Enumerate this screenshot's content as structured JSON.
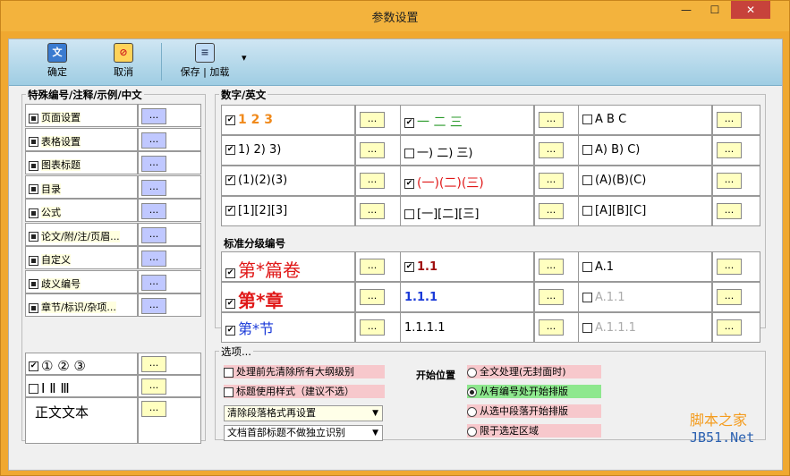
{
  "window": {
    "title": "参数设置",
    "minimize": "—",
    "maximize": "☐",
    "close": "✕"
  },
  "toolbar": {
    "confirm": "确定",
    "cancel": "取消",
    "saveload": "保存 | 加载",
    "confirm_icon": "文",
    "cancel_icon": "⊘",
    "save_icon": "≡",
    "drop": "▾"
  },
  "left": {
    "title": "特殊编号/注释/示例/中文",
    "items": [
      "页面设置",
      "表格设置",
      "图表标题",
      "目录",
      "公式",
      "论文/附/注/页眉...",
      "自定义",
      "歧义编号",
      "章节/标识/杂项..."
    ],
    "circ": "① ② ③",
    "roman": "Ⅰ Ⅱ Ⅲ",
    "body": "正文文本"
  },
  "dots": "...",
  "num": {
    "title": "数字/英文",
    "rows": [
      [
        "1 2 3",
        "一 二 三",
        "A B C"
      ],
      [
        "1) 2) 3)",
        "一) 二) 三)",
        "A) B) C)"
      ],
      [
        "(1)(2)(3)",
        "(一)(二)(三)",
        "(A)(B)(C)"
      ],
      [
        "[1][2][3]",
        "[一][二][三]",
        "[A][B][C]"
      ]
    ]
  },
  "lvl": {
    "title": "标准分级编号",
    "rows": [
      [
        "第*篇卷",
        "1.1",
        "A.1"
      ],
      [
        "第*章",
        "1.1.1",
        "A.1.1"
      ],
      [
        "第*节",
        "1.1.1.1",
        "A.1.1.1"
      ]
    ]
  },
  "opt": {
    "title": "选项...",
    "clear": "处理前先清除所有大纲级别",
    "style": "标题使用样式（建议不选）",
    "sel1": "清除段落格式再设置",
    "sel2": "文档首部标题不做独立识别",
    "start": "开始位置",
    "r1": "全文处理(无封面时)",
    "r2": "从有编号处开始排版",
    "r3": "从选中段落开始排版",
    "r4": "限于选定区域"
  },
  "watermark": {
    "cn": "脚本之家",
    "en": "JB51.Net"
  },
  "check": "✔",
  "colors": {
    "orange": "#f08a1c",
    "green": "#2a9a2a",
    "red": "#e01818",
    "blue": "#1a3ad8",
    "gray": "#aaaaaa"
  }
}
